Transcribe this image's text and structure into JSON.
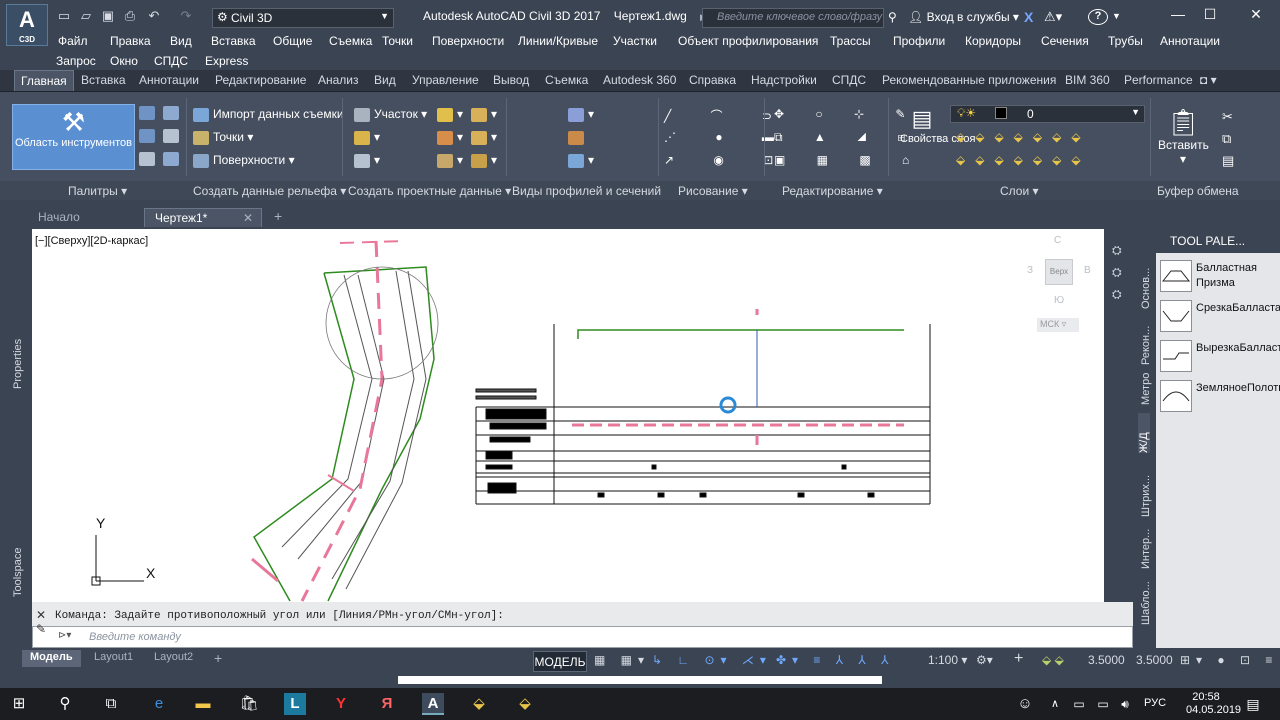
{
  "app": {
    "logo_letter": "A",
    "logo_sub": "C3D",
    "title": "Autodesk AutoCAD Civil 3D 2017",
    "file": "Чертеж1.dwg"
  },
  "workspace": "Civil 3D",
  "search_placeholder": "Введите ключевое слово/фразу",
  "signin": "Вход в службы",
  "menu_row1": [
    "Файл",
    "Правка",
    "Вид",
    "Вставка",
    "Общие",
    "Съемка",
    "Точки",
    "Поверхности",
    "Линии/Кривые",
    "Участки",
    "Объект профилирования",
    "Трассы",
    "Профили",
    "Коридоры",
    "Сечения",
    "Трубы",
    "Аннотации"
  ],
  "menu_row2": [
    "Запрос",
    "Окно",
    "СПДС",
    "Express"
  ],
  "ribbon_tabs": [
    "Главная",
    "Вставка",
    "Аннотации",
    "Редактирование",
    "Анализ",
    "Вид",
    "Управление",
    "Вывод",
    "Съемка",
    "Autodesk 360",
    "Справка",
    "Надстройки",
    "СПДС",
    "Рекомендованные приложения",
    "BIM 360",
    "Performance"
  ],
  "ribbon": {
    "tool_area": "Область инструментов",
    "import_survey": "Импорт данных съемки",
    "points": "Точки",
    "surfaces": "Поверхности",
    "parcel": "Участок",
    "layer_props": "Свойства слоя",
    "layer_value": "0",
    "paste": "Вставить",
    "panels": [
      "Палитры",
      "Создать данные рельефа",
      "Создать проектные данные",
      "Виды профилей и сечений",
      "Рисование",
      "Редактирование",
      "Слои",
      "Буфер обмена"
    ]
  },
  "doc_tabs": [
    "Начало",
    "Чертеж1*"
  ],
  "viewport_label": "[−][Сверху][2D-каркас]",
  "viewcube": {
    "north": "С",
    "south": "Ю",
    "west": "З",
    "east": "В",
    "top": "Верх",
    "ucs": "МСК"
  },
  "axis": {
    "x": "X",
    "y": "Y"
  },
  "left_tabs": [
    "Properties",
    "Toolspace"
  ],
  "right_tabs": [
    "Основ...",
    "Рекон...",
    "Метро",
    "Ж/Д",
    "Штрих...",
    "Интер...",
    "Шабло..."
  ],
  "palette": {
    "title": "TOOL PALE...",
    "items": [
      "Балластная Призма",
      "СрезкаБалластаИзем...",
      "ВырезкаБалласта",
      "ЗемляноеПолотно"
    ]
  },
  "command": {
    "history": "Команда: Задайте противоположный угол или [Линия/РМн-угол/СМн-угол]:",
    "placeholder": "Введите команду"
  },
  "layout_tabs": [
    "Модель",
    "Layout1",
    "Layout2"
  ],
  "status": {
    "model": "МОДЕЛЬ",
    "scale": "1:100",
    "val1": "3.5000",
    "val2": "3.5000"
  },
  "taskbar": {
    "time": "20:58",
    "date": "04.05.2019",
    "lang": "РУС"
  },
  "colors": {
    "accent": "#5a8fd2",
    "dark_bg": "#3b4453",
    "ribbon_bg": "#464f5f",
    "drawing_pink": "#e8779a",
    "drawing_green": "#2e8b1f"
  }
}
